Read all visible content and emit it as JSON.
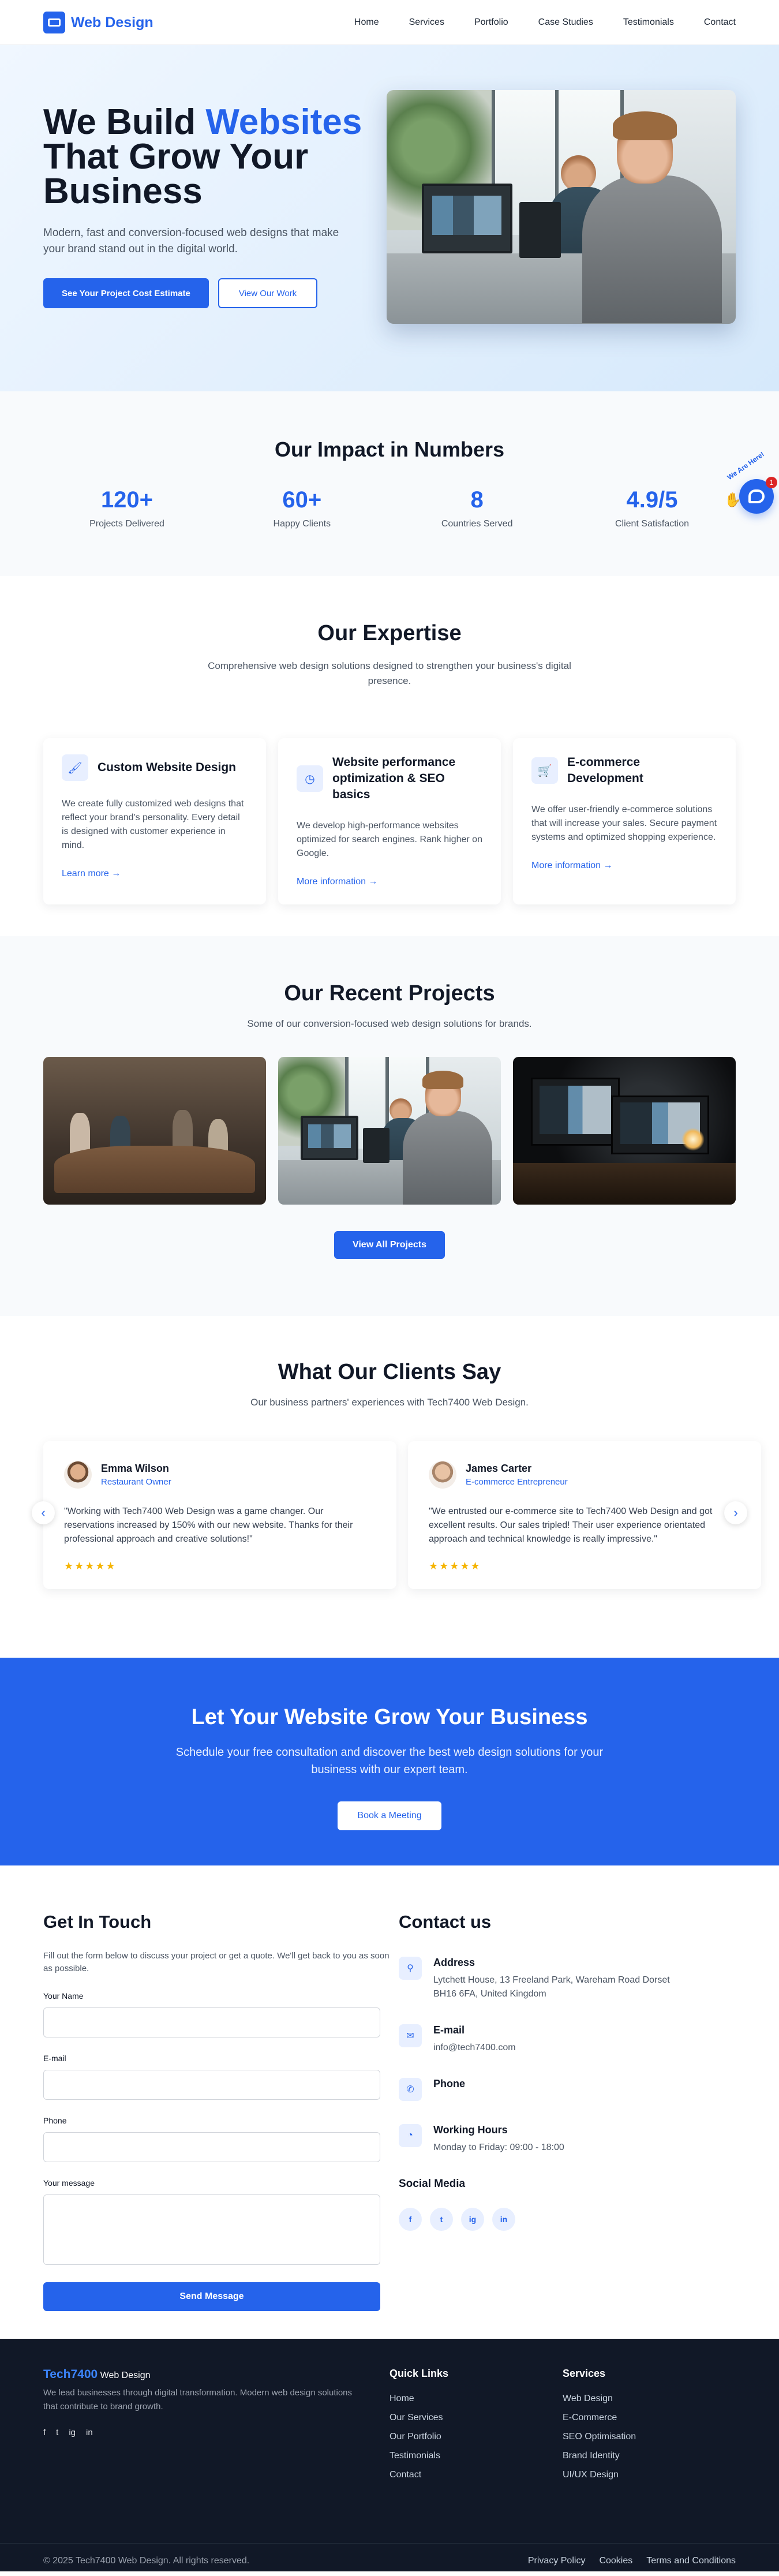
{
  "brand": {
    "name": "Web Design"
  },
  "nav": {
    "items": [
      "Home",
      "Services",
      "Portfolio",
      "Case Studies",
      "Testimonials",
      "Contact"
    ]
  },
  "hero": {
    "title_pre": "We Build ",
    "title_accent": "Websites",
    "title_post": "That Grow Your Business",
    "subtitle": "Modern, fast and conversion-focused web designs that make your brand stand out in the digital world.",
    "primary_button": "See Your Project Cost Estimate",
    "secondary_button": "View Our Work"
  },
  "impact": {
    "title": "Our Impact in Numbers",
    "stats": [
      {
        "value": "120+",
        "label": "Projects Delivered"
      },
      {
        "value": "60+",
        "label": "Happy Clients"
      },
      {
        "value": "8",
        "label": "Countries Served"
      },
      {
        "value": "4.9/5",
        "label": "Client Satisfaction"
      }
    ]
  },
  "chat": {
    "arc_text": "We Are Here!",
    "badge": "1"
  },
  "expertise": {
    "title": "Our Expertise",
    "subtitle": "Comprehensive web design solutions designed to strengthen your business's digital presence.",
    "cards": [
      {
        "icon": "brush-icon",
        "title": "Custom Website Design",
        "text": "We create fully customized web designs that reflect your brand's personality. Every detail is designed with customer experience in mind.",
        "link": "Learn more"
      },
      {
        "icon": "gauge-icon",
        "title": "Website performance optimization & SEO basics",
        "text": "We develop high-performance websites optimized for search engines. Rank higher on Google.",
        "link": "More information"
      },
      {
        "icon": "cart-icon",
        "title": "E-commerce Development",
        "text": "We offer user-friendly e-commerce solutions that will increase your sales. Secure payment systems and optimized shopping experience.",
        "link": "More information"
      }
    ]
  },
  "projects": {
    "title": "Our Recent Projects",
    "subtitle": "Some of our conversion-focused web design solutions for brands.",
    "button": "View All Projects"
  },
  "testimonials": {
    "title": "What Our Clients Say",
    "subtitle": "Our business partners' experiences with Tech7400 Web Design.",
    "items": [
      {
        "name": "Emma Wilson",
        "role": "Restaurant Owner",
        "quote": "\"Working with Tech7400 Web Design was a game changer. Our reservations increased by 150% with our new website. Thanks for their professional approach and creative solutions!\"",
        "stars": "★★★★★"
      },
      {
        "name": "James Carter",
        "role": "E-commerce Entrepreneur",
        "quote": "\"We entrusted our e-commerce site to Tech7400 Web Design and got excellent results. Our sales tripled! Their user experience orientated approach and technical knowledge is really impressive.\"",
        "stars": "★★★★★"
      }
    ]
  },
  "cta": {
    "title": "Let Your Website Grow Your Business",
    "text": "Schedule your free consultation and discover the best web design solutions for your business with our expert team.",
    "button": "Book a Meeting"
  },
  "contact": {
    "form_title": "Get In Touch",
    "form_intro": "Fill out the form below to discuss your project or get a quote. We'll get back to you as soon as possible.",
    "labels": {
      "name": "Your Name",
      "email": "E-mail",
      "phone": "Phone",
      "message": "Your message"
    },
    "send_button": "Send Message",
    "info_title": "Contact us",
    "address_title": "Address",
    "address": "Lytchett House, 13 Freeland Park, Wareham Road Dorset BH16 6FA, United Kingdom",
    "email_title": "E-mail",
    "email": "info@tech7400.com",
    "phone_title": "Phone",
    "hours_title": "Working Hours",
    "hours": "Monday to Friday: 09:00 - 18:00",
    "social_title": "Social Media",
    "socials": [
      "f",
      "t",
      "ig",
      "in"
    ]
  },
  "footer": {
    "brand_accent": "Tech7400",
    "brand_rest": "Web Design",
    "description": "We lead businesses through digital transformation. Modern web design solutions that contribute to brand growth.",
    "icons": [
      "f",
      "t",
      "ig",
      "in"
    ],
    "quick_title": "Quick Links",
    "quick_links": [
      "Home",
      "Our Services",
      "Our Portfolio",
      "Testimonials",
      "Contact"
    ],
    "services_title": "Services",
    "services": [
      "Web Design",
      "E-Commerce",
      "SEO Optimisation",
      "Brand Identity",
      "UI/UX Design"
    ],
    "copyright": "© 2025 Tech7400 Web Design. All rights reserved.",
    "legal": [
      "Privacy Policy",
      "Cookies",
      "Terms and Conditions"
    ]
  },
  "colors": {
    "accent": "#2563eb",
    "dark": "#111827",
    "star": "#f5b400"
  }
}
